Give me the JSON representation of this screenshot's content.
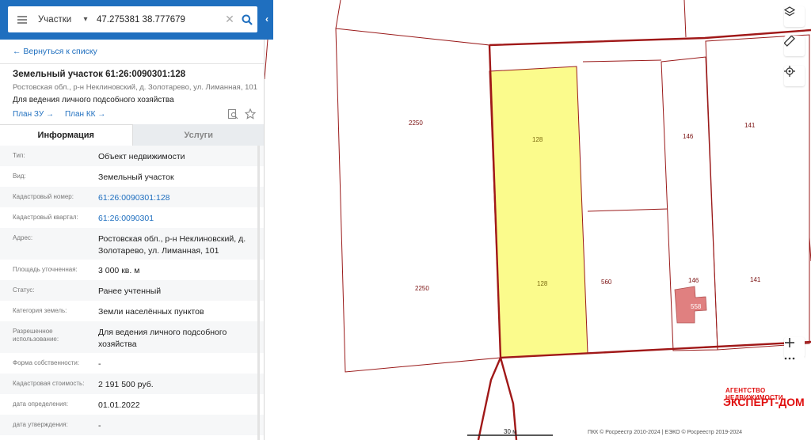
{
  "search": {
    "layer_label": "Участки",
    "query": "47.275381 38.777679"
  },
  "panel": {
    "back_label": "← Вернуться к списку",
    "title": "Земельный участок 61:26:0090301:128",
    "address_short": "Ростовская обл., р-н Неклиновский, д. Золотарево, ул. Лиманная, 101",
    "usage": "Для ведения личного подсобного хозяйства",
    "plan_zu": "План ЗУ →",
    "plan_kk": "План КК →"
  },
  "tabs": [
    {
      "label": "Информация"
    },
    {
      "label": "Услуги"
    }
  ],
  "info_rows": [
    {
      "label": "Тип:",
      "value": "Объект недвижимости"
    },
    {
      "label": "Вид:",
      "value": "Земельный участок"
    },
    {
      "label": "Кадастровый номер:",
      "value": "61:26:0090301:128"
    },
    {
      "label": "Кадастровый квартал:",
      "value": "61:26:0090301"
    },
    {
      "label": "Адрес:",
      "value": "Ростовская обл., р-н Неклиновский, д. Золотарево, ул. Лиманная, 101"
    },
    {
      "label": "Площадь уточненная:",
      "value": "3 000 кв. м"
    },
    {
      "label": "Статус:",
      "value": "Ранее учтенный"
    },
    {
      "label": "Категория земель:",
      "value": "Земли населённых пунктов"
    },
    {
      "label": "Разрешенное использование:",
      "value": "Для ведения личного подсобного хозяйства"
    },
    {
      "label": "Форма собственности:",
      "value": "-"
    },
    {
      "label": "Кадастровая стоимость:",
      "value": "2 191 500 руб."
    },
    {
      "label": "дата определения:",
      "value": "01.01.2022"
    },
    {
      "label": "дата утверждения:",
      "value": "-"
    }
  ],
  "map": {
    "parcel_labels": [
      "2250",
      "2250",
      "128",
      "128",
      "146",
      "146",
      "141",
      "141",
      "560",
      "558"
    ],
    "scale_label": "30 м",
    "footer": "ПКК © Росреестр 2010-2024 | ЕЭКО © Росреестр 2019-2024",
    "watermark_line1": "АГЕНТСТВО НЕДВИЖИМОСТИ",
    "watermark_line2": "ЭКСПЕРТ-ДОМ"
  },
  "colors": {
    "header": "#1f6fbf",
    "parcel_border": "#9a1a1a",
    "selected_fill": "#fbfb8c",
    "building_fill": "#e08080"
  },
  "icons": {
    "menu": "hamburger-icon",
    "dropdown": "chevron-down-icon",
    "clear": "close-icon",
    "search": "search-icon",
    "collapse": "chevron-left-icon",
    "layers": "layers-icon",
    "ruler": "ruler-icon",
    "locate": "crosshair-icon",
    "zoom_in": "plus-icon",
    "more": "more-icon"
  }
}
